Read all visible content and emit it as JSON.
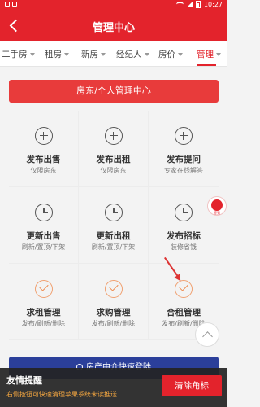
{
  "status_bar": {
    "time": "10:27"
  },
  "header": {
    "title": "管理中心"
  },
  "tabs": [
    {
      "label": "二手房"
    },
    {
      "label": "租房"
    },
    {
      "label": "新房"
    },
    {
      "label": "经纪人"
    },
    {
      "label": "房价"
    },
    {
      "label": "管理"
    }
  ],
  "banner": {
    "label": "房东/个人管理中心"
  },
  "grid": [
    {
      "label": "发布出售",
      "sub": "仅限房东",
      "icon": "plus-circle-icon"
    },
    {
      "label": "发布出租",
      "sub": "仅限房东",
      "icon": "plus-circle-icon"
    },
    {
      "label": "发布提问",
      "sub": "专家在线解答",
      "icon": "plus-circle-icon"
    },
    {
      "label": "更新出售",
      "sub": "刷新/置顶/下架",
      "icon": "clock-icon"
    },
    {
      "label": "更新出租",
      "sub": "刷新/置顶/下架",
      "icon": "clock-icon"
    },
    {
      "label": "发布招标",
      "sub": "装修省钱",
      "icon": "clock-icon"
    },
    {
      "label": "求租管理",
      "sub": "发布/刷新/删除",
      "icon": "check-circle-icon"
    },
    {
      "label": "求购管理",
      "sub": "发布/刷新/删除",
      "icon": "check-circle-icon"
    },
    {
      "label": "合租管理",
      "sub": "发布/刷新/删除",
      "icon": "check-circle-icon"
    }
  ],
  "float_badge": {
    "text": "签到"
  },
  "bottom_bar": {
    "label": "房产中介快速登陆"
  },
  "toast": {
    "title": "友情提醒",
    "message": "右侧按钮可快速清理苹果系统未读推送",
    "button": "清除角标"
  },
  "colors": {
    "accent": "#e3232c",
    "bottom_bar": "#2b3f9a",
    "check": "#ef8a4c"
  }
}
